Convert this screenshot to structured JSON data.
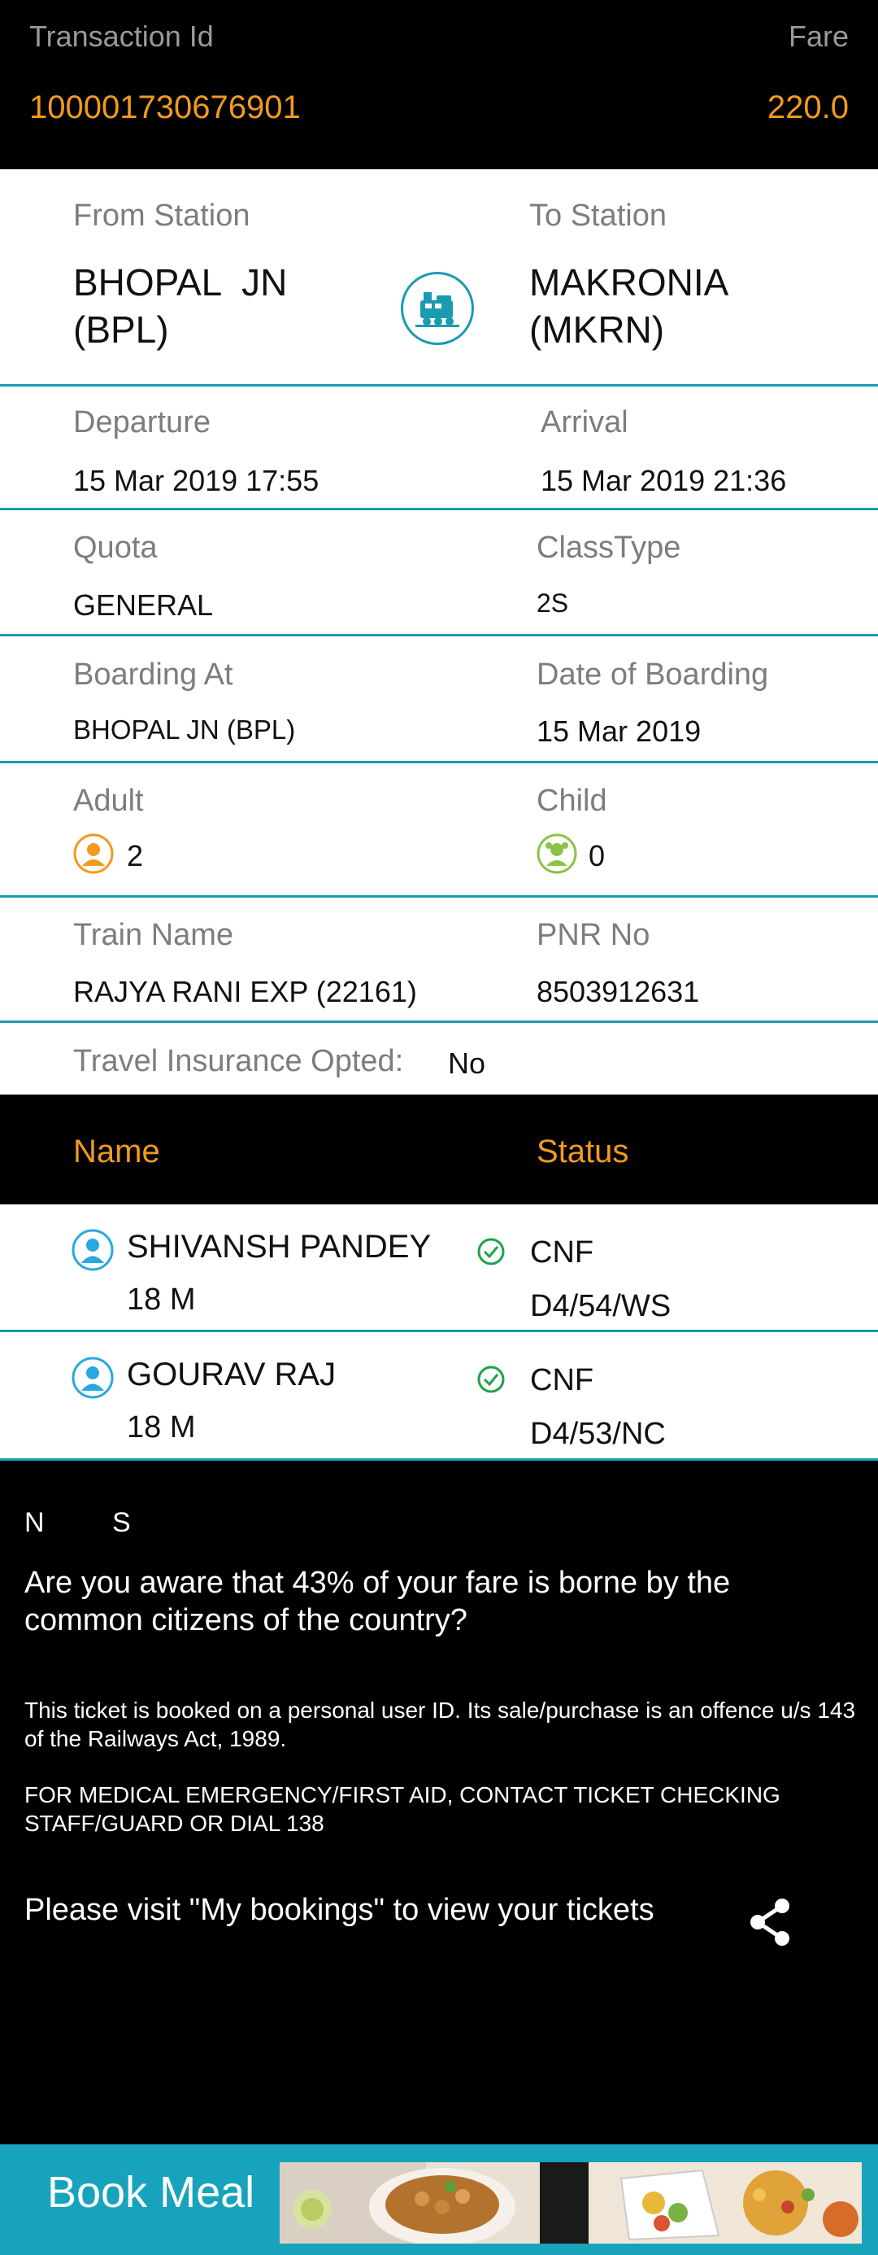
{
  "header": {
    "txn_label": "Transaction Id",
    "txn_value": "100001730676901",
    "fare_label": "Fare",
    "fare_value": "220.0"
  },
  "journey": {
    "from_label": "From Station",
    "from_station": "BHOPAL  JN\n(BPL)",
    "to_label": "To Station",
    "to_station": "MAKRONIA\n(MKRN)",
    "departure_label": "Departure",
    "departure_value": "15 Mar 2019  17:55",
    "arrival_label": "Arrival",
    "arrival_value": "15 Mar 2019  21:36",
    "quota_label": "Quota",
    "quota_value": "GENERAL",
    "class_label": "ClassType",
    "class_value": "2S",
    "boarding_label": "Boarding At",
    "boarding_value": "BHOPAL  JN (BPL)",
    "boarding_date_label": "Date of Boarding",
    "boarding_date_value": "15 Mar 2019",
    "adult_label": "Adult",
    "adult_value": "2",
    "child_label": "Child",
    "child_value": "0",
    "train_label": "Train Name",
    "train_value": "RAJYA RANI EXP (22161)",
    "pnr_label": "PNR No",
    "pnr_value": "8503912631",
    "insurance_label": "Travel Insurance Opted:",
    "insurance_value": "No"
  },
  "passengers_header": {
    "name": "Name",
    "status": "Status"
  },
  "passengers": [
    {
      "name": "SHIVANSH PANDEY",
      "info": "18 M",
      "status": "CNF",
      "berth": "D4/54/WS"
    },
    {
      "name": "GOURAV RAJ",
      "info": "18 M",
      "status": "CNF",
      "berth": "D4/53/NC"
    }
  ],
  "footer": {
    "ns_n": "N",
    "ns_s": "S",
    "subsidy_text": "Are you aware that 43% of your fare is borne by the common citizens of the country?",
    "personal_id_text": "This ticket is booked on a personal user ID. Its sale/purchase is an offence u/s 143 of the Railways Act, 1989.",
    "medical_text": "FOR MEDICAL EMERGENCY/FIRST AID, CONTACT TICKET CHECKING STAFF/GUARD OR DIAL 138",
    "bookings_text": "Please visit \"My bookings\" to view your tickets",
    "share_icon": "share-icon"
  },
  "meal_banner": {
    "label": "Book Meal"
  },
  "colors": {
    "accent_orange": "#f29a1e",
    "teal": "#1a9bb0",
    "banner_teal": "#17a3bb",
    "confirm_green": "#1aa34a"
  }
}
